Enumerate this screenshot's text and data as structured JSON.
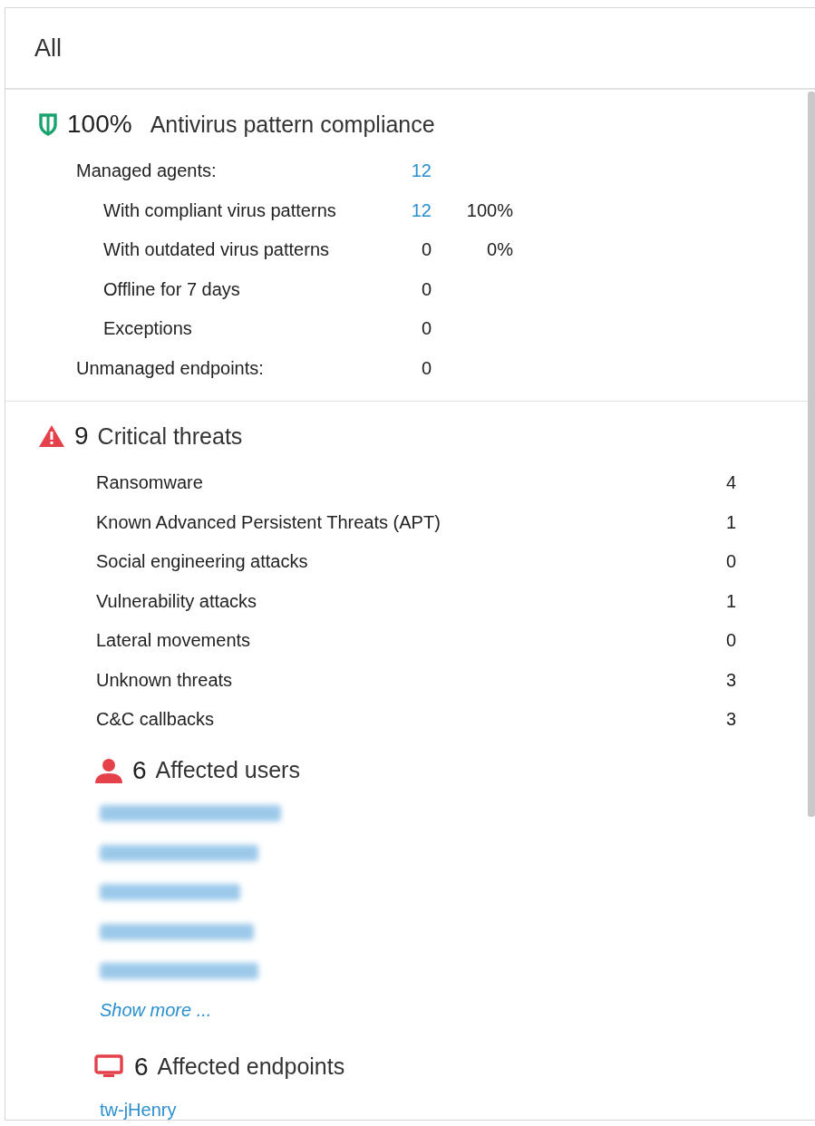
{
  "header": {
    "title": "All"
  },
  "compliance": {
    "percent": "100%",
    "title": "Antivirus pattern compliance",
    "rows": [
      {
        "label": "Managed agents:",
        "count": "12",
        "link": true,
        "children": [
          {
            "label": "With compliant virus patterns",
            "count": "12",
            "link": true,
            "percent": "100%"
          },
          {
            "label": "With outdated virus patterns",
            "count": "0",
            "link": false,
            "percent": "0%"
          },
          {
            "label": "Offline for 7 days",
            "count": "0",
            "link": false
          },
          {
            "label": "Exceptions",
            "count": "0",
            "link": false
          }
        ]
      },
      {
        "label": "Unmanaged endpoints:",
        "count": "0",
        "link": false
      }
    ]
  },
  "threats": {
    "count": "9",
    "title": "Critical threats",
    "rows": [
      {
        "label": "Ransomware",
        "count": "4"
      },
      {
        "label": "Known Advanced Persistent Threats (APT)",
        "count": "1"
      },
      {
        "label": "Social engineering attacks",
        "count": "0"
      },
      {
        "label": "Vulnerability attacks",
        "count": "1"
      },
      {
        "label": "Lateral movements",
        "count": "0"
      },
      {
        "label": "Unknown threats",
        "count": "3"
      },
      {
        "label": "C&C callbacks",
        "count": "3"
      }
    ],
    "users": {
      "count": "6",
      "title": "Affected users",
      "items": [
        {
          "kind": "redacted"
        },
        {
          "kind": "redacted"
        },
        {
          "kind": "redacted"
        },
        {
          "kind": "redacted"
        },
        {
          "kind": "redacted"
        }
      ],
      "more": "Show more ..."
    },
    "endpoints": {
      "count": "6",
      "title": "Affected endpoints",
      "items": [
        {
          "kind": "link",
          "text": "tw-jHenry"
        }
      ]
    }
  }
}
